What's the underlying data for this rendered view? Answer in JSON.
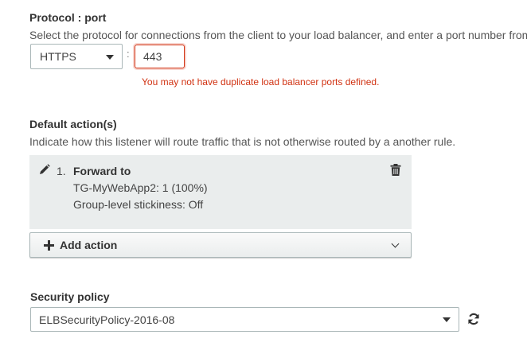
{
  "protocol_port": {
    "label": "Protocol : port",
    "description": "Select the protocol for connections from the client to your load balancer, and enter a port number from",
    "protocol_value": "HTTPS",
    "separator": ":",
    "port_value": "443",
    "error": "You may not have duplicate load balancer ports defined."
  },
  "default_actions": {
    "label": "Default action(s)",
    "description": "Indicate how this listener will route traffic that is not otherwise routed by a another rule.",
    "action": {
      "number": "1.",
      "title": "Forward to",
      "target": "TG-MyWebApp2: 1 (100%)",
      "stickiness": "Group-level stickiness: Off"
    },
    "add_action_label": "Add action"
  },
  "security_policy": {
    "label": "Security policy",
    "value": "ELBSecurityPolicy-2016-08"
  },
  "colors": {
    "error": "#d13212",
    "border": "#aab7b8",
    "action_bg": "#eaeded"
  }
}
